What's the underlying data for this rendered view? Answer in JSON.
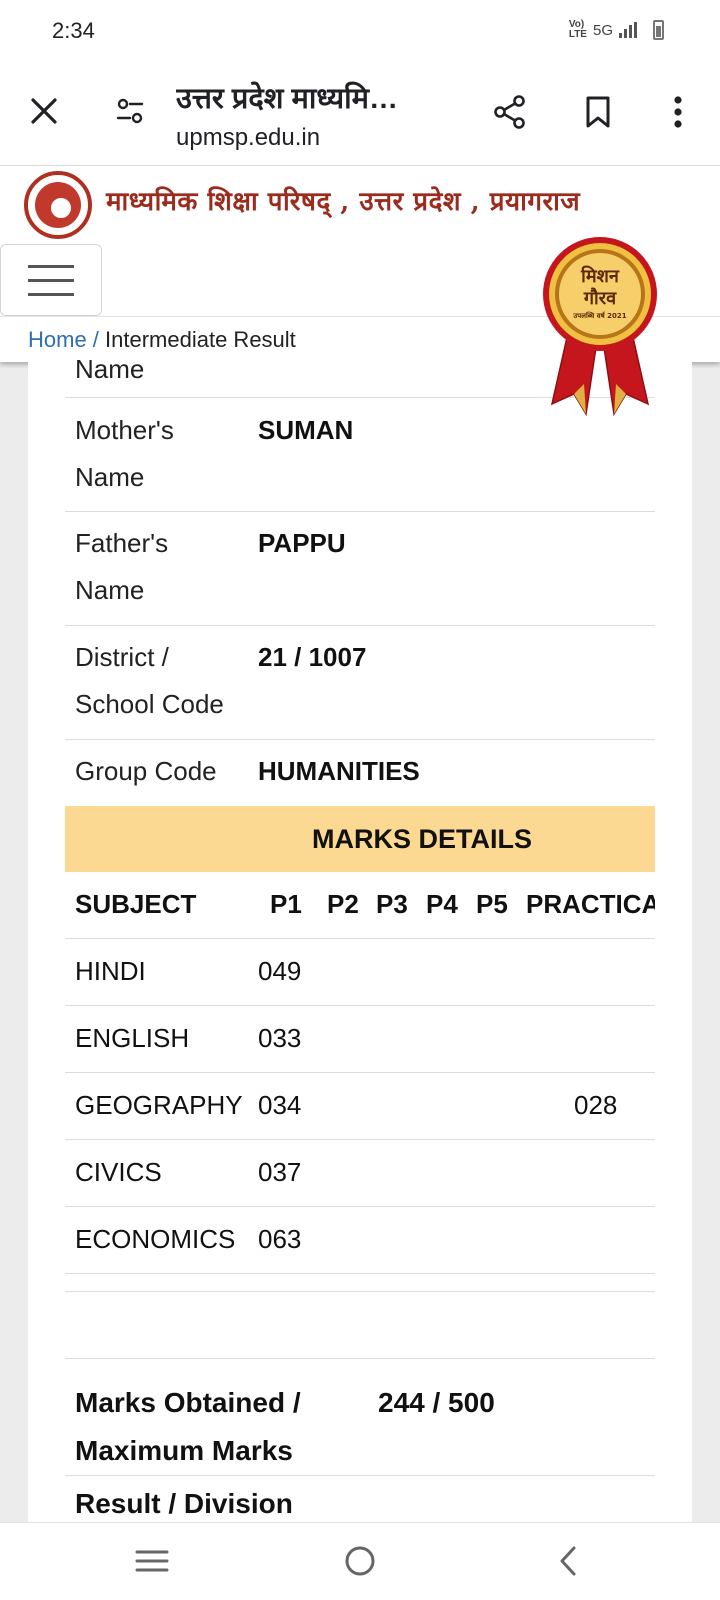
{
  "status_bar": {
    "time": "2:34",
    "network": "5G",
    "lte_label": "Vo) LTE"
  },
  "browser": {
    "page_title": "उत्तर प्रदेश माध्यमि…",
    "url": "upmsp.edu.in",
    "icons": [
      "close-icon",
      "tune-icon",
      "share-icon",
      "bookmark-icon",
      "more-vert-icon"
    ]
  },
  "site": {
    "org_name": "माध्यमिक शिक्षा परिषद् , उत्तर प्रदेश , प्रयागराज",
    "badge_line1": "मिशन",
    "badge_line2": "गौरव",
    "badge_line3": "उपलब्धि वर्ष 2021",
    "breadcrumb_home": "Home",
    "breadcrumb_sep": " / ",
    "breadcrumb_current": "Intermediate Result"
  },
  "student": {
    "partial_label": "Name",
    "mother_label_1": "Mother's",
    "mother_label_2": "Name",
    "mother_value": "SUMAN",
    "father_label_1": "Father's",
    "father_label_2": "Name",
    "father_value": "PAPPU",
    "district_label_1": "District /",
    "district_label_2": "School Code",
    "district_value": "21 / 1007",
    "group_label": "Group Code",
    "group_value": "HUMANITIES"
  },
  "marks": {
    "heading": "MARKS DETAILS",
    "columns": [
      "SUBJECT",
      "P1",
      "P2",
      "P3",
      "P4",
      "P5",
      "PRACTICAL"
    ],
    "rows": [
      {
        "subject": "HINDI",
        "p1": "049",
        "practical": ""
      },
      {
        "subject": "ENGLISH",
        "p1": "033",
        "practical": ""
      },
      {
        "subject": "GEOGRAPHY",
        "p1": "034",
        "practical": "028"
      },
      {
        "subject": "CIVICS",
        "p1": "037",
        "practical": ""
      },
      {
        "subject": "ECONOMICS",
        "p1": "063",
        "practical": ""
      }
    ]
  },
  "totals": {
    "label_1": "Marks Obtained /",
    "label_2": "Maximum Marks",
    "value": "244 / 500",
    "result_partial": "Result / Division"
  },
  "nav": {
    "icons": [
      "recent-apps-icon",
      "home-icon",
      "back-icon"
    ]
  }
}
